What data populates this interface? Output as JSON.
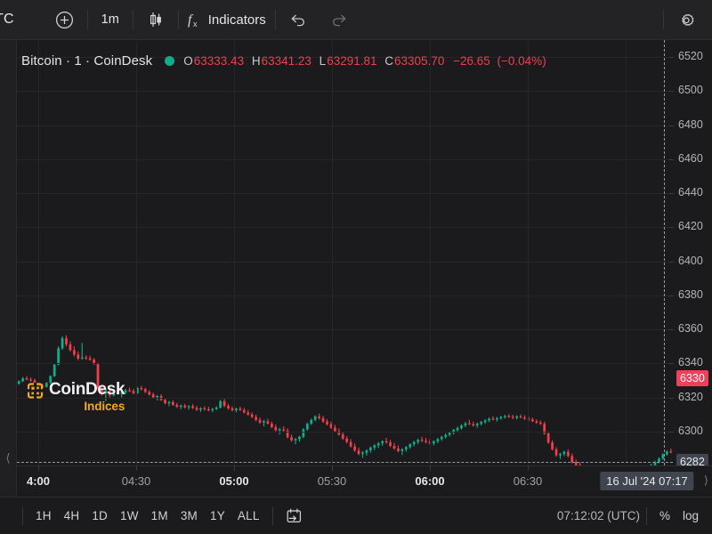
{
  "toolbar": {
    "symbol_text": "TC",
    "add_icon": "plus-circle-icon",
    "interval_label": "1m",
    "chart_type_icon": "candlestick-icon",
    "indicators_icon": "fx-icon",
    "indicators_label": "Indicators",
    "undo_icon": "undo-arrow-icon",
    "redo_icon": "redo-arrow-icon",
    "settings_icon": "gear-icon"
  },
  "legend": {
    "title": "Bitcoin · 1 · CoinDesk",
    "status_dot_color": "#0fae8a",
    "o_key": "O",
    "o_val": "63333.43",
    "h_key": "H",
    "h_val": "63341.23",
    "l_key": "L",
    "l_val": "63291.81",
    "c_key": "C",
    "c_val": "63305.70",
    "change_abs": "−26.65",
    "change_pct": "(−0.04%)",
    "negative_color": "#ef3f4b"
  },
  "watermark": {
    "line1": "CoinDesk",
    "line2": "Indices",
    "accent": "#f2a91b"
  },
  "price_axis": {
    "ticks": [
      "6520",
      "6500",
      "6480",
      "6460",
      "6440",
      "6420",
      "6400",
      "6380",
      "6360",
      "6340",
      "6320",
      "6300"
    ],
    "current_price": "6330",
    "current_color": "#f2405a",
    "crosshair_price": "6282"
  },
  "time_axis": {
    "ticks": [
      {
        "label": "4:00",
        "major": true
      },
      {
        "label": "04:30",
        "major": false
      },
      {
        "label": "05:00",
        "major": true
      },
      {
        "label": "05:30",
        "major": false
      },
      {
        "label": "06:00",
        "major": true
      },
      {
        "label": "06:30",
        "major": false
      }
    ],
    "crosshair_label": "16 Jul '24   07:17"
  },
  "bottombar": {
    "timeframes": [
      "1H",
      "4H",
      "1D",
      "1W",
      "1M",
      "3M",
      "1Y",
      "ALL"
    ],
    "calendar_icon": "calendar-goto-icon",
    "clock": "07:12:02 (UTC)",
    "percent_label": "%",
    "log_label": "log"
  },
  "chart_data": {
    "type": "candlestick",
    "title": "Bitcoin · 1 · CoinDesk",
    "xlabel": "",
    "ylabel": "",
    "ylim": [
      62800,
      65300
    ],
    "ytick_values": [
      65200,
      65000,
      64800,
      64600,
      64400,
      64200,
      64000,
      63800,
      63600,
      63400,
      63200,
      63000
    ],
    "grid": true,
    "up_color": "#0fae8a",
    "down_color": "#ef3f4b",
    "last_close": 63305.7,
    "candles": [
      [
        63280,
        63300,
        63275,
        63295
      ],
      [
        63295,
        63320,
        63290,
        63312
      ],
      [
        63312,
        63325,
        63300,
        63305
      ],
      [
        63305,
        63318,
        63292,
        63300
      ],
      [
        63300,
        63310,
        63270,
        63278
      ],
      [
        63278,
        63290,
        63262,
        63268
      ],
      [
        63268,
        63280,
        63255,
        63262
      ],
      [
        63262,
        63290,
        63258,
        63285
      ],
      [
        63285,
        63330,
        63282,
        63325
      ],
      [
        63325,
        63400,
        63320,
        63392
      ],
      [
        63392,
        63500,
        63388,
        63488
      ],
      [
        63488,
        63560,
        63480,
        63548
      ],
      [
        63548,
        63565,
        63500,
        63512
      ],
      [
        63512,
        63530,
        63470,
        63478
      ],
      [
        63478,
        63500,
        63440,
        63452
      ],
      [
        63452,
        63470,
        63418,
        63428
      ],
      [
        63428,
        63520,
        63422,
        63435
      ],
      [
        63435,
        63448,
        63420,
        63430
      ],
      [
        63430,
        63445,
        63415,
        63422
      ],
      [
        63422,
        63432,
        63390,
        63398
      ],
      [
        63398,
        63405,
        63240,
        63252
      ],
      [
        63252,
        63268,
        63210,
        63222
      ],
      [
        63222,
        63250,
        63178,
        63240
      ],
      [
        63240,
        63258,
        63200,
        63212
      ],
      [
        63212,
        63245,
        63205,
        63238
      ],
      [
        63238,
        63252,
        63215,
        63222
      ],
      [
        63222,
        63235,
        63200,
        63228
      ],
      [
        63228,
        63250,
        63220,
        63242
      ],
      [
        63242,
        63258,
        63232,
        63238
      ],
      [
        63238,
        63250,
        63218,
        63225
      ],
      [
        63225,
        63262,
        63220,
        63255
      ],
      [
        63255,
        63268,
        63240,
        63248
      ],
      [
        63248,
        63258,
        63225,
        63232
      ],
      [
        63232,
        63242,
        63210,
        63218
      ],
      [
        63218,
        63228,
        63192,
        63200
      ],
      [
        63200,
        63215,
        63182,
        63208
      ],
      [
        63208,
        63218,
        63178,
        63185
      ],
      [
        63185,
        63196,
        63158,
        63166
      ],
      [
        63166,
        63180,
        63148,
        63172
      ],
      [
        63172,
        63182,
        63150,
        63156
      ],
      [
        63156,
        63168,
        63138,
        63145
      ],
      [
        63145,
        63158,
        63130,
        63152
      ],
      [
        63152,
        63162,
        63135,
        63142
      ],
      [
        63142,
        63155,
        63128,
        63148
      ],
      [
        63148,
        63160,
        63132,
        63138
      ],
      [
        63138,
        63150,
        63120,
        63128
      ],
      [
        63128,
        63142,
        63115,
        63136
      ],
      [
        63136,
        63148,
        63122,
        63130
      ],
      [
        63130,
        63145,
        63118,
        63125
      ],
      [
        63125,
        63138,
        63112,
        63132
      ],
      [
        63132,
        63148,
        63125,
        63140
      ],
      [
        63140,
        63185,
        63135,
        63178
      ],
      [
        63178,
        63192,
        63142,
        63150
      ],
      [
        63150,
        63162,
        63128,
        63136
      ],
      [
        63136,
        63148,
        63118,
        63125
      ],
      [
        63125,
        63140,
        63112,
        63134
      ],
      [
        63134,
        63146,
        63120,
        63126
      ],
      [
        63126,
        63138,
        63105,
        63112
      ],
      [
        63112,
        63125,
        63092,
        63100
      ],
      [
        63100,
        63112,
        63078,
        63085
      ],
      [
        63085,
        63098,
        63060,
        63068
      ],
      [
        63068,
        63082,
        63045,
        63052
      ],
      [
        63052,
        63068,
        63030,
        63060
      ],
      [
        63060,
        63075,
        63040,
        63046
      ],
      [
        63046,
        63058,
        63018,
        63025
      ],
      [
        63025,
        63040,
        63000,
        63008
      ],
      [
        63008,
        63022,
        62982,
        63012
      ],
      [
        63012,
        63030,
        62995,
        63005
      ],
      [
        63005,
        63018,
        62958,
        62966
      ],
      [
        62966,
        62982,
        62940,
        62948
      ],
      [
        62948,
        62962,
        62925,
        62955
      ],
      [
        62955,
        62975,
        62940,
        62968
      ],
      [
        62968,
        63020,
        62960,
        63012
      ],
      [
        63012,
        63052,
        63005,
        63045
      ],
      [
        63045,
        63075,
        63038,
        63068
      ],
      [
        63068,
        63095,
        63060,
        63088
      ],
      [
        63088,
        63105,
        63070,
        63078
      ],
      [
        63078,
        63092,
        63050,
        63058
      ],
      [
        63058,
        63072,
        63035,
        63042
      ],
      [
        63042,
        63058,
        63015,
        63022
      ],
      [
        63022,
        63038,
        62995,
        63002
      ],
      [
        63002,
        63018,
        62975,
        62982
      ],
      [
        62982,
        62998,
        62950,
        62958
      ],
      [
        62958,
        62972,
        62930,
        62938
      ],
      [
        62938,
        62955,
        62905,
        62912
      ],
      [
        62912,
        62930,
        62880,
        62888
      ],
      [
        62888,
        62905,
        62860,
        62868
      ],
      [
        62868,
        62885,
        62845,
        62875
      ],
      [
        62875,
        62895,
        62858,
        62888
      ],
      [
        62888,
        62912,
        62875,
        62905
      ],
      [
        62905,
        62925,
        62890,
        62918
      ],
      [
        62918,
        62938,
        62902,
        62930
      ],
      [
        62930,
        62948,
        62915,
        62942
      ],
      [
        62942,
        62962,
        62928,
        62935
      ],
      [
        62935,
        62950,
        62908,
        62915
      ],
      [
        62915,
        62932,
        62892,
        62900
      ],
      [
        62900,
        62918,
        62878,
        62885
      ],
      [
        62885,
        62902,
        62862,
        62895
      ],
      [
        62895,
        62915,
        62880,
        62908
      ],
      [
        62908,
        62930,
        62898,
        62925
      ],
      [
        62925,
        62945,
        62912,
        62938
      ],
      [
        62938,
        62958,
        62925,
        62950
      ],
      [
        62950,
        62968,
        62938,
        62945
      ],
      [
        62945,
        62962,
        62930,
        62938
      ],
      [
        62938,
        62955,
        62922,
        62930
      ],
      [
        62930,
        62948,
        62918,
        62942
      ],
      [
        62942,
        62962,
        62930,
        62955
      ],
      [
        62955,
        62975,
        62945,
        62968
      ],
      [
        62968,
        62988,
        62958,
        62980
      ],
      [
        62980,
        63000,
        62970,
        62992
      ],
      [
        62992,
        63015,
        62982,
        63008
      ],
      [
        63008,
        63028,
        62998,
        63020
      ],
      [
        63020,
        63042,
        63010,
        63035
      ],
      [
        63035,
        63055,
        63025,
        63048
      ],
      [
        63048,
        63068,
        63038,
        63042
      ],
      [
        63042,
        63058,
        63028,
        63035
      ],
      [
        63035,
        63052,
        63022,
        63045
      ],
      [
        63045,
        63062,
        63035,
        63055
      ],
      [
        63055,
        63072,
        63045,
        63065
      ],
      [
        63065,
        63082,
        63055,
        63075
      ],
      [
        63075,
        63090,
        63065,
        63070
      ],
      [
        63070,
        63085,
        63058,
        63078
      ],
      [
        63078,
        63092,
        63068,
        63085
      ],
      [
        63085,
        63098,
        63075,
        63090
      ],
      [
        63090,
        63102,
        63080,
        63086
      ],
      [
        63086,
        63098,
        63072,
        63080
      ],
      [
        63080,
        63095,
        63070,
        63088
      ],
      [
        63088,
        63100,
        63078,
        63082
      ],
      [
        63082,
        63095,
        63068,
        63075
      ],
      [
        63075,
        63088,
        63062,
        63070
      ],
      [
        63070,
        63082,
        63055,
        63060
      ],
      [
        63060,
        63072,
        63045,
        63052
      ],
      [
        63052,
        63065,
        63038,
        63045
      ],
      [
        63045,
        63058,
        62980,
        62988
      ],
      [
        62988,
        63000,
        62928,
        62935
      ],
      [
        62935,
        62948,
        62888,
        62895
      ],
      [
        62895,
        62908,
        62852,
        62860
      ],
      [
        62860,
        62875,
        62838,
        62868
      ],
      [
        62868,
        62888,
        62855,
        62880
      ],
      [
        62880,
        62895,
        62848,
        62856
      ],
      [
        62856,
        62870,
        62812,
        62820
      ],
      [
        62820,
        62835,
        62795,
        62802
      ],
      [
        62802,
        62818,
        62775,
        62782
      ],
      [
        62782,
        62798,
        62742,
        62750
      ],
      [
        62750,
        62765,
        62712,
        62720
      ],
      [
        62720,
        62735,
        62688,
        62695
      ],
      [
        62695,
        62710,
        62660,
        62668
      ],
      [
        62668,
        62682,
        62632,
        62640
      ],
      [
        62640,
        62655,
        62612,
        62620
      ],
      [
        62620,
        62635,
        62590,
        62598
      ],
      [
        62598,
        62612,
        62572,
        62580
      ],
      [
        62580,
        62595,
        62558,
        62582
      ],
      [
        62582,
        62700,
        62575,
        62695
      ],
      [
        62695,
        62760,
        62688,
        62752
      ],
      [
        62752,
        62768,
        62735,
        62742
      ],
      [
        62742,
        62758,
        62730,
        62750
      ],
      [
        62750,
        62768,
        62742,
        62760
      ],
      [
        62760,
        62778,
        62750,
        62755
      ],
      [
        62755,
        62772,
        62745,
        62765
      ],
      [
        62765,
        62790,
        62758,
        62782
      ],
      [
        62782,
        62810,
        62775,
        62802
      ],
      [
        62802,
        62828,
        62795,
        62820
      ],
      [
        62820,
        62848,
        62812,
        62840
      ],
      [
        62840,
        62872,
        62832,
        62865
      ],
      [
        62865,
        62890,
        62858,
        62882
      ],
      [
        62882,
        62900,
        62872,
        62878
      ]
    ]
  }
}
